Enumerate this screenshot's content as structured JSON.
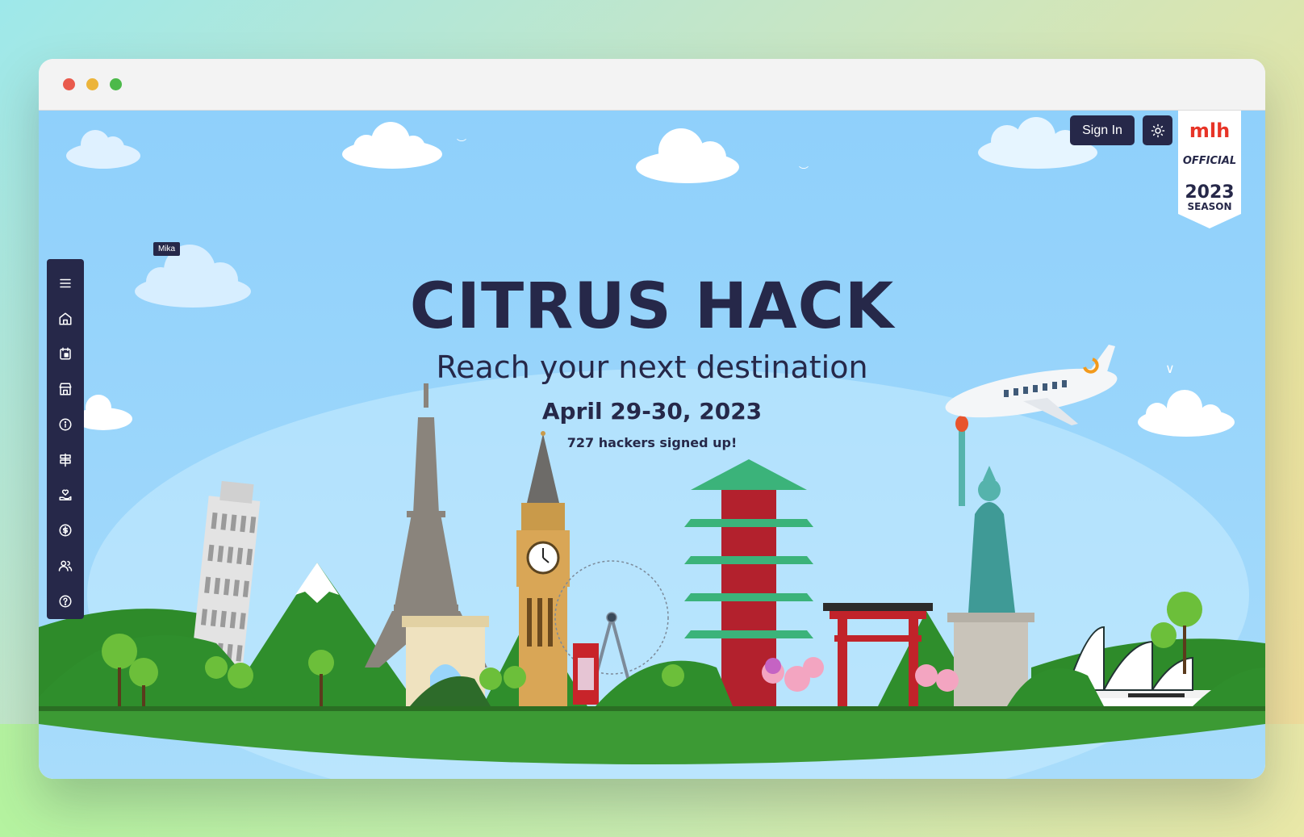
{
  "window": {
    "controls": [
      "close",
      "minimize",
      "maximize"
    ]
  },
  "header": {
    "sign_in_label": "Sign In",
    "theme_toggle_icon": "sun-icon",
    "mlh_badge": {
      "logo": "mlh",
      "line1": "OFFICIAL",
      "line2": "2023",
      "line3": "SEASON"
    }
  },
  "sidebar": {
    "tooltip": "Mika",
    "items": [
      {
        "icon": "menu-icon"
      },
      {
        "icon": "home-icon"
      },
      {
        "icon": "calendar-icon"
      },
      {
        "icon": "store-icon"
      },
      {
        "icon": "info-icon"
      },
      {
        "icon": "signpost-icon"
      },
      {
        "icon": "hand-heart-icon"
      },
      {
        "icon": "dollar-icon"
      },
      {
        "icon": "users-icon"
      },
      {
        "icon": "help-icon"
      }
    ]
  },
  "hero": {
    "title": "CITRUS HACK",
    "subtitle": "Reach your next destination",
    "date": "April 29-30, 2023",
    "signups": "727 hackers signed up!"
  },
  "colors": {
    "navy": "#262849",
    "sky": "#93d2fb",
    "grass": "#3c9a34"
  }
}
